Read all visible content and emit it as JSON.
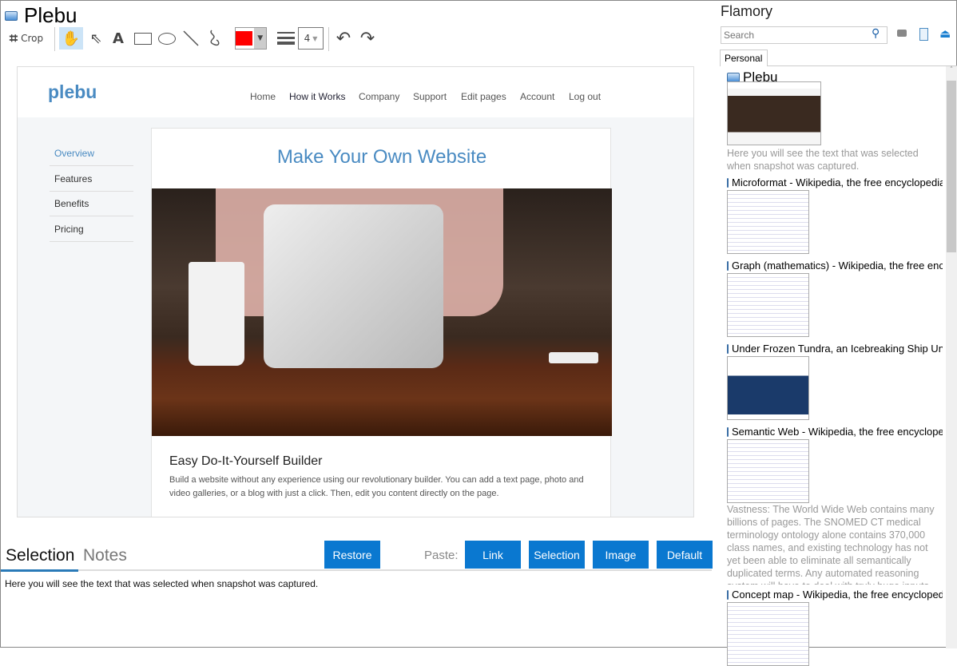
{
  "window": {
    "title": "Plebu"
  },
  "toolbar": {
    "crop_label": "Crop",
    "line_width": "4",
    "color": "#ff0000",
    "tools": [
      "hand-tool",
      "pointer-tool",
      "text-tool",
      "rectangle-tool",
      "ellipse-tool",
      "line-tool",
      "freehand-tool"
    ]
  },
  "preview": {
    "logo": "plebu",
    "nav": [
      "Home",
      "How it Works",
      "Company",
      "Support",
      "Edit pages",
      "Account",
      "Log out"
    ],
    "sidebar": [
      "Overview",
      "Features",
      "Benefits",
      "Pricing"
    ],
    "headline": "Make Your Own Website",
    "section_title": "Easy Do-It-Yourself Builder",
    "section_text": "Build a website without any experience using our revolutionary builder. You can add a text page, photo and video galleries, or a blog with just a click. Then, edit you content directly on the page."
  },
  "bottom": {
    "tabs": [
      "Selection",
      "Notes"
    ],
    "restore": "Restore",
    "paste_label": "Paste:",
    "paste_buttons": [
      "Link",
      "Selection",
      "Image",
      "Default"
    ],
    "selection_text": "Here you will see the text that was selected when snapshot was captured."
  },
  "panel": {
    "title": "Flamory",
    "search_placeholder": "Search",
    "tab": "Personal",
    "items": [
      {
        "title": "Plebu",
        "desc": "Here you will see the text that was selected when snapshot was captured."
      },
      {
        "title": "Microformat - Wikipedia, the free encyclopedia"
      },
      {
        "title": "Graph (mathematics) - Wikipedia, the free encyclopedia"
      },
      {
        "title": "Under Frozen Tundra, an Icebreaking Ship Uncovers"
      },
      {
        "title": "Semantic Web - Wikipedia, the free encyclopedia",
        "desc": "Vastness: The World Wide Web contains many billions of pages. The SNOMED CT medical terminology ontology alone contains 370,000 class names, and existing technology has not yet been able to eliminate all semantically duplicated terms. Any automated reasoning system will have to deal with truly huge inputs."
      },
      {
        "title": "Concept map - Wikipedia, the free encyclopedia"
      }
    ]
  },
  "colors": {
    "accent": "#0a78d0",
    "link": "#4a8bc2"
  }
}
